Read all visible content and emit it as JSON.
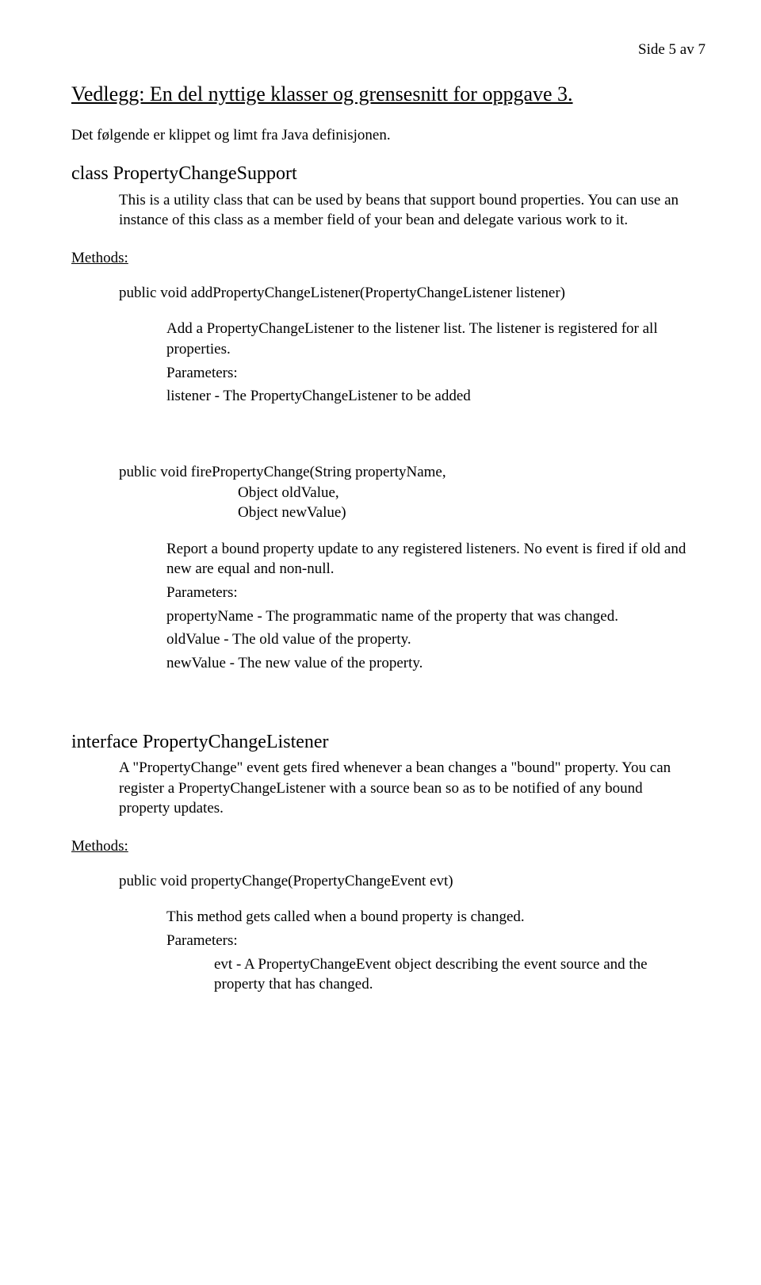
{
  "pageNumber": "Side 5 av 7",
  "title": "Vedlegg: En del nyttige klasser og grensesnitt for oppgave 3.",
  "intro": "Det følgende er klippet og limt fra Java definisjonen.",
  "class1": {
    "heading": "class PropertyChangeSupport",
    "desc": "This is a utility class that can be used by beans that support bound properties. You can use an instance of this class as a member field of your bean and delegate various work to it."
  },
  "methodsLabel": "Methods:",
  "method1": {
    "sig": "public void addPropertyChangeListener(PropertyChangeListener listener)",
    "desc": "Add a PropertyChangeListener to the listener list. The listener is registered for all properties.",
    "paramsLabel": "Parameters:",
    "param1": "listener - The PropertyChangeListener to be added"
  },
  "method2": {
    "sigLine1": "public void firePropertyChange(String propertyName,",
    "sigLine2": "Object oldValue,",
    "sigLine3": "Object newValue)",
    "desc": "Report a bound property update to any registered listeners. No event is fired if old and new are equal and non-null.",
    "paramsLabel": "Parameters:",
    "param1": "propertyName - The programmatic name of the property that was changed.",
    "param2": "oldValue - The old value of the property.",
    "param3": "newValue - The new value of the property."
  },
  "interface1": {
    "heading": "interface PropertyChangeListener",
    "desc": "A \"PropertyChange\" event gets fired whenever a bean changes a \"bound\" property. You can register a PropertyChangeListener with a source bean so as to be notified of any bound property updates."
  },
  "method3": {
    "sig": "public void propertyChange(PropertyChangeEvent evt)",
    "desc": "This method gets called when a bound property is changed.",
    "paramsLabel": "Parameters:",
    "param1": "evt - A PropertyChangeEvent object describing the event source and the property that has changed."
  }
}
